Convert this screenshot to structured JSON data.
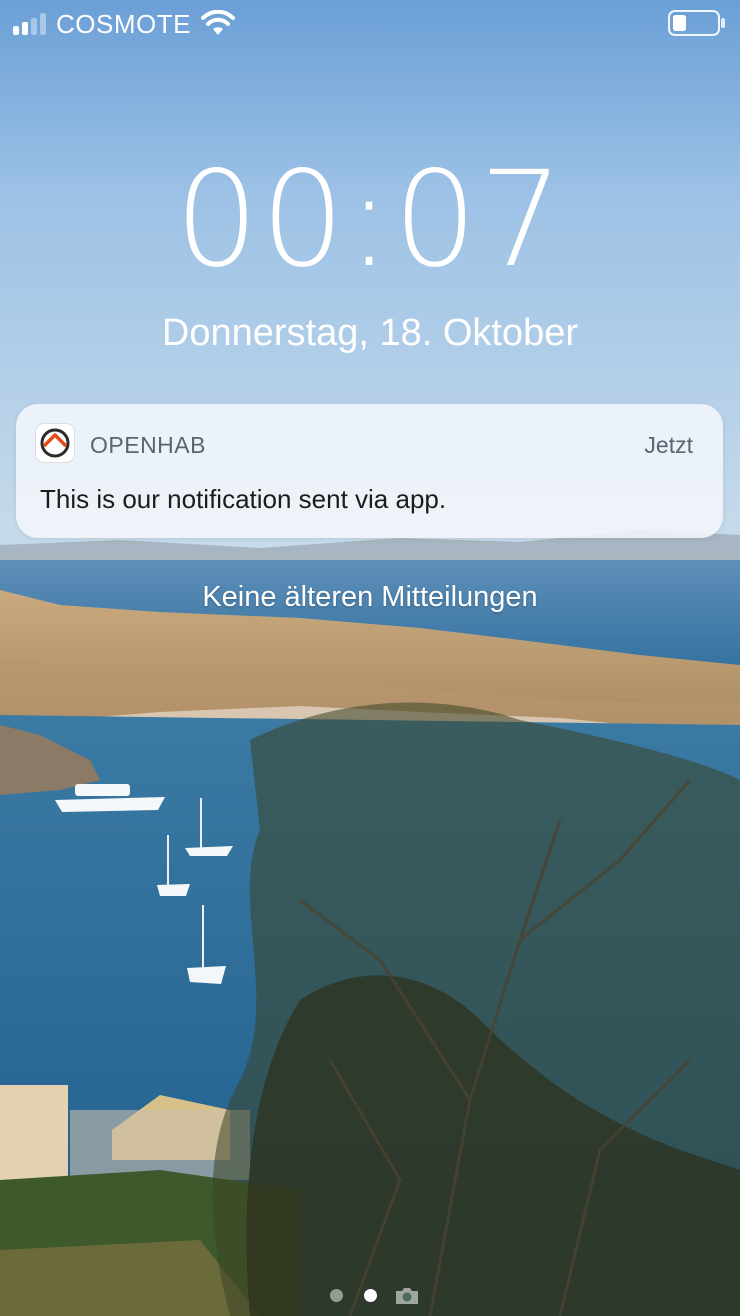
{
  "status_bar": {
    "carrier": "COSMOTE",
    "signal_bars_filled": 2,
    "signal_bars_total": 4,
    "wifi_icon": "wifi-icon",
    "battery_icon": "battery-icon",
    "battery_level": 0.3
  },
  "lock_screen": {
    "time": "00:07",
    "date": "Donnerstag, 18. Oktober"
  },
  "notification": {
    "app_icon": "openhab-icon",
    "app_name": "OPENHAB",
    "time": "Jetzt",
    "message": "This is our notification sent via app.",
    "accent_color": "#e64a19"
  },
  "no_older_notifications": "Keine älteren Mitteilungen",
  "page_indicator": {
    "pages": 2,
    "active": 1,
    "camera_icon": "camera-icon"
  }
}
